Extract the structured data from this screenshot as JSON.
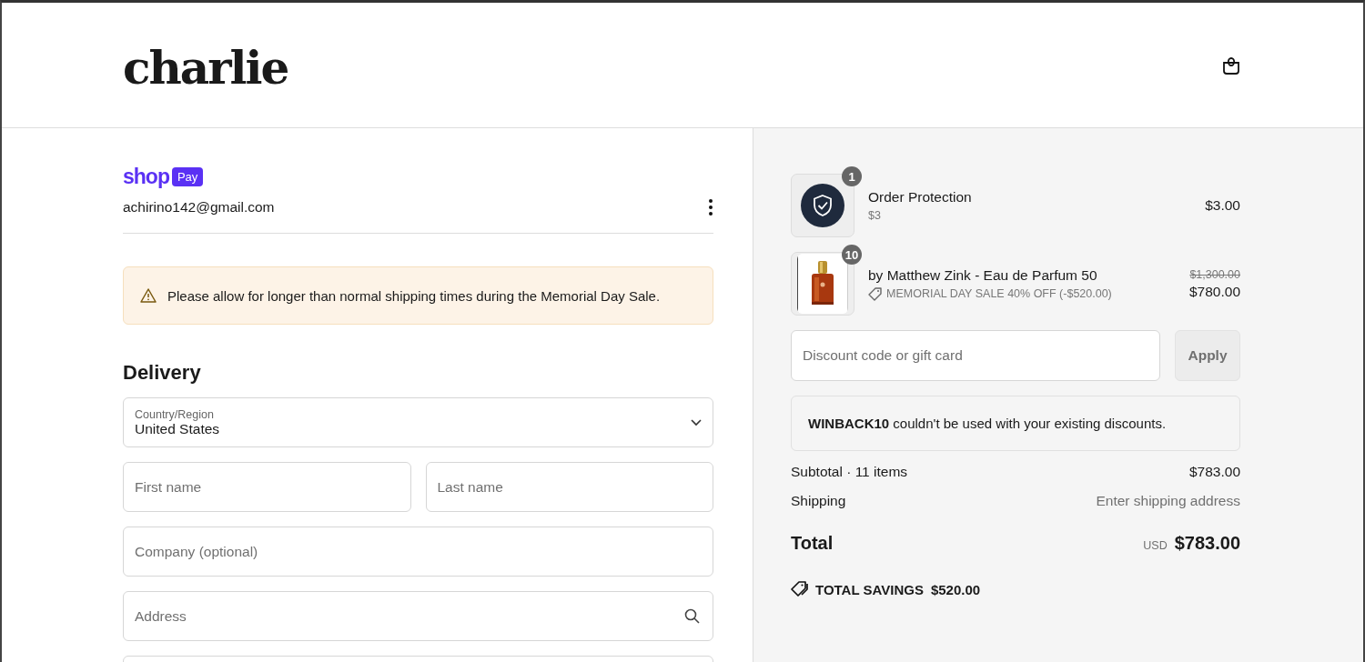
{
  "header": {
    "logo": "charlie"
  },
  "account": {
    "brand": "shop",
    "badge": "Pay",
    "email": "achirino142@gmail.com"
  },
  "notice": {
    "text": "Please allow for longer than normal shipping times during the Memorial Day Sale."
  },
  "delivery": {
    "heading": "Delivery",
    "country": {
      "label": "Country/Region",
      "value": "United States"
    },
    "rows": [
      {
        "fields": [
          {
            "placeholder": "First name",
            "kind": "text"
          },
          {
            "placeholder": "Last name",
            "kind": "text"
          }
        ]
      },
      {
        "fields": [
          {
            "placeholder": "Company (optional)",
            "kind": "text"
          }
        ]
      },
      {
        "fields": [
          {
            "placeholder": "Address",
            "kind": "search"
          }
        ]
      }
    ]
  },
  "order": {
    "items": [
      {
        "kind": "protection",
        "name": "Order Protection",
        "detail": "$3",
        "quantity": "1",
        "price": "$3.00"
      },
      {
        "kind": "picture",
        "name": "by Matthew Zink - Eau de Parfum 50",
        "discount": "MEMORIAL DAY SALE 40% OFF (-$520.00)",
        "quantity": "10",
        "original_price": "$1,300.00",
        "price": "$780.00"
      }
    ],
    "discount": {
      "placeholder": "Discount code or gift card",
      "button": "Apply"
    },
    "message": "**WINBACK10** couldn't be used with your existing discounts.",
    "summary": [
      {
        "label": "Subtotal · 11 items",
        "value": "$783.00",
        "kind": "amount"
      },
      {
        "label": "Shipping",
        "value": "Enter shipping address",
        "kind": "hint"
      }
    ],
    "total": {
      "label": "Total",
      "currency": "USD",
      "value": "$783.00"
    },
    "savings": {
      "label": "TOTAL SAVINGS",
      "value": "$520.00"
    }
  }
}
